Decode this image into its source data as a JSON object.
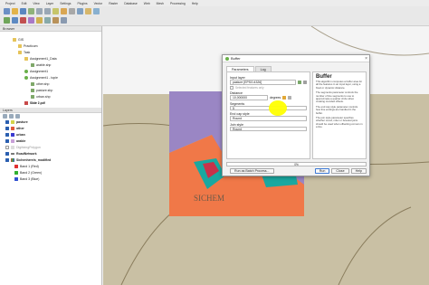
{
  "menu": [
    "Project",
    "Edit",
    "View",
    "Layer",
    "Settings",
    "Plugins",
    "Vector",
    "Raster",
    "Database",
    "Web",
    "Mesh",
    "Processing",
    "Help"
  ],
  "browser": {
    "title": "Browser",
    "items": [
      "GIS",
      "Practicum",
      "Task",
      "Assignment1_Data",
      "arable.shp",
      "Assignment1",
      "Assignment1 - topie",
      "other.shp",
      "pasture.shp",
      "urban.shp",
      "Slide 1.pdf",
      "Slide 2.pdf"
    ]
  },
  "layers": {
    "title": "Layers",
    "items": [
      "pasture",
      "other",
      "urban",
      "arable",
      "DigitizingPolygon",
      "RoadNetwork",
      "Sichenhereis_modified",
      "Band 1 (Red)",
      "Band 2 (Green)",
      "Band 3 (Blue)"
    ]
  },
  "map": {
    "label": "SICHEM"
  },
  "dialog": {
    "title": "Buffer",
    "tabs": [
      "Parameters",
      "Log"
    ],
    "input_layer_label": "Input layer",
    "input_layer_value": "pasture [EPSG:4326]",
    "selected_only": "Selected features only",
    "distance_label": "Distance",
    "distance_value": "10,000000",
    "distance_unit": "degrees",
    "segments_label": "Segments",
    "segments_value": "5",
    "end_cap_label": "End cap style",
    "end_cap_value": "Round",
    "join_label": "Join style",
    "join_value": "Round",
    "progress": "0%",
    "batch_button": "Run as Batch Process...",
    "run_button": "Run",
    "close_button": "Close",
    "help_button": "Help",
    "help_title": "Buffer",
    "help_p1": "This algorithm computes a buffer area for all the features in an input layer, using a fixed or dynamic distance.",
    "help_p2": "The segments parameter controls the number of line segments to use to approximate a quarter circle when creating rounded offsets.",
    "help_p3": "The end cap style parameter controls how line endings are handled in the buffer.",
    "help_p4": "The join style parameter specifies whether round, miter or beveled joins should be used when offsetting corners in a line."
  },
  "colors": {
    "pasture": "#d4d44a",
    "other": "#e05a3a",
    "urban": "#3a3ad0",
    "arable": "#c8a0d8",
    "buffer_orange": "#f07848",
    "buffer_purple": "#9a86c4"
  }
}
